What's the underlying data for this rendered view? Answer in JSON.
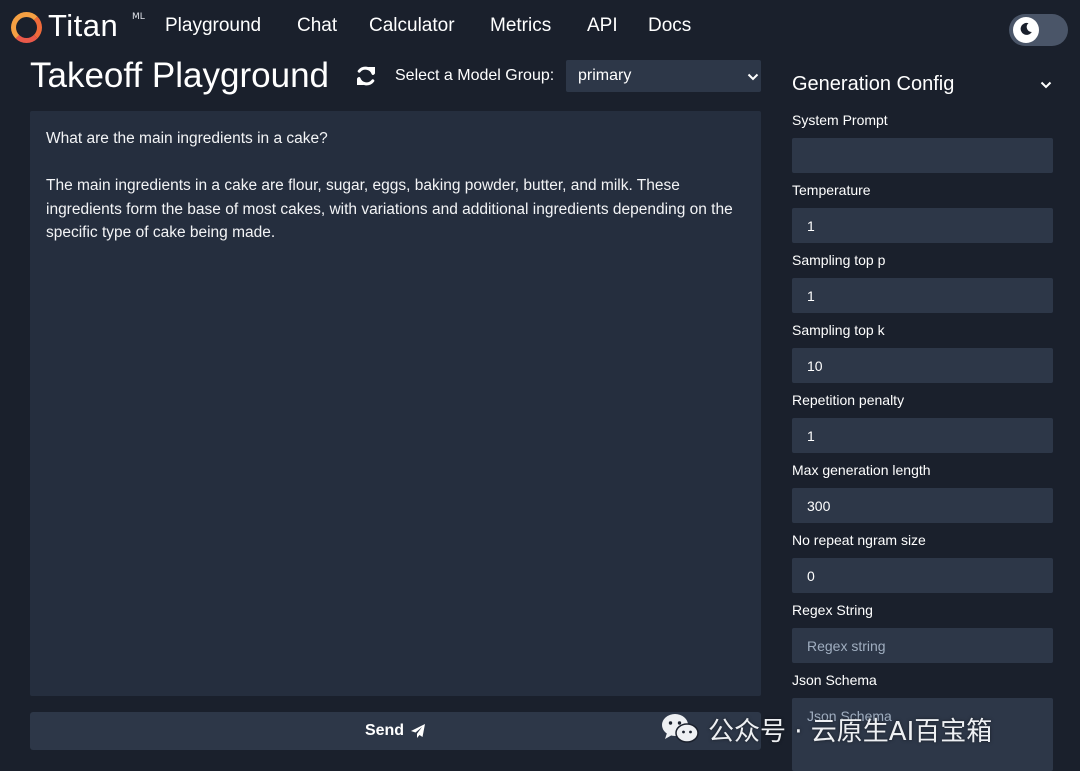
{
  "colors": {
    "background": "#1a202c",
    "panel": "#252e3e",
    "input": "#2d3748",
    "accent_orange": "#f5a043",
    "text": "#ffffff",
    "placeholder": "#a0aec0"
  },
  "nav": {
    "logo_text": "Titan",
    "logo_superscript": "ML",
    "links": [
      "Playground",
      "Chat",
      "Calculator",
      "Metrics",
      "API",
      "Docs"
    ],
    "theme_toggle_icon": "moon-icon"
  },
  "header": {
    "title": "Takeoff Playground",
    "refresh_icon": "refresh-icon",
    "model_group_label": "Select a Model Group:",
    "model_group_value": "primary"
  },
  "main": {
    "prompt": "What are the main ingredients in a cake?",
    "response": "The main ingredients in a cake are flour, sugar, eggs, baking powder, butter, and milk. These ingredients form the base of most cakes, with variations and additional ingredients depending on the specific type of cake being made.",
    "send_label": "Send",
    "send_icon": "paper-plane-icon"
  },
  "config": {
    "title": "Generation Config",
    "fields": [
      {
        "label": "System Prompt",
        "value": "",
        "placeholder": ""
      },
      {
        "label": "Temperature",
        "value": "1",
        "placeholder": ""
      },
      {
        "label": "Sampling top p",
        "value": "1",
        "placeholder": ""
      },
      {
        "label": "Sampling top k",
        "value": "10",
        "placeholder": ""
      },
      {
        "label": "Repetition penalty",
        "value": "1",
        "placeholder": ""
      },
      {
        "label": "Max generation length",
        "value": "300",
        "placeholder": ""
      },
      {
        "label": "No repeat ngram size",
        "value": "0",
        "placeholder": ""
      },
      {
        "label": "Regex String",
        "value": "",
        "placeholder": "Regex string"
      },
      {
        "label": "Json Schema",
        "value": "",
        "placeholder": "Json Schema"
      }
    ]
  },
  "watermark": {
    "text": "公众号 · 云原生AI百宝箱",
    "icon": "wechat-icon"
  }
}
